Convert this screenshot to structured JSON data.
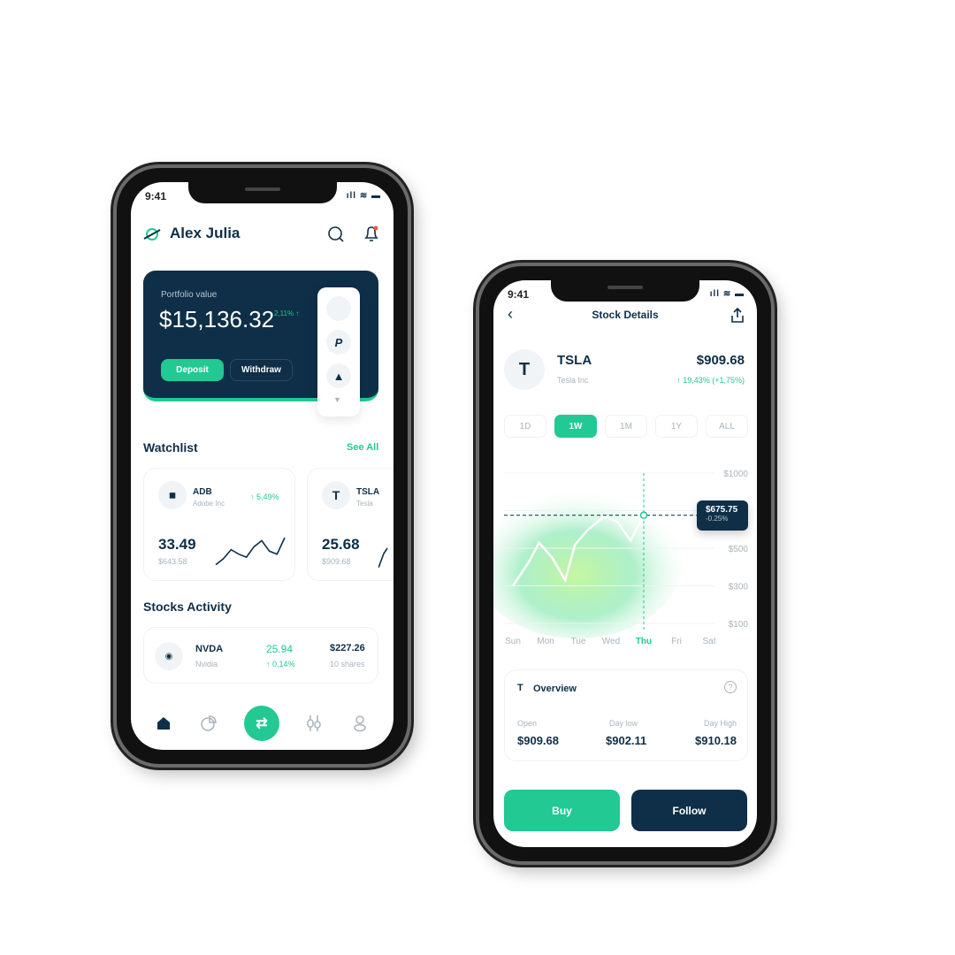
{
  "colors": {
    "navy": "#0e2f47",
    "green": "#22c992",
    "muted": "#a9b3bd"
  },
  "home": {
    "status": {
      "time": "9:41"
    },
    "header": {
      "logo_icon": "planet-icon",
      "user_name": "Alex Julia",
      "search_icon": "search-icon",
      "bell_icon": "bell-icon"
    },
    "portfolio": {
      "label": "Portfolio value",
      "value": "$15,136.32",
      "change": "2,11% ↑",
      "deposit": "Deposit",
      "withdraw": "Withdraw",
      "payment_icons": [
        "apple-icon",
        "paypal-icon",
        "atlassian-icon"
      ]
    },
    "watchlist": {
      "title": "Watchlist",
      "see_all": "See All",
      "items": [
        {
          "ticker": "ADB",
          "name": "Adobe Inc",
          "change": "↑ 5,49%",
          "value": "33.49",
          "price": "$643.58",
          "spark": [
            2,
            6,
            12,
            9,
            7,
            14,
            18,
            11,
            9,
            20
          ]
        },
        {
          "ticker": "TSLA",
          "name": "Tesla",
          "value": "25.68",
          "price": "$909.68",
          "spark": [
            2,
            8,
            14
          ]
        }
      ]
    },
    "activity": {
      "title": "Stocks Activity",
      "items": [
        {
          "ticker": "NVDA",
          "name": "Nvidia",
          "value": "25.94",
          "change": "↑ 0,14%",
          "amount": "$227.26",
          "shares": "10 shares"
        }
      ]
    },
    "nav": [
      "home-icon",
      "pie-chart-icon",
      "transfer-icon",
      "candlestick-icon",
      "profile-icon"
    ]
  },
  "details": {
    "status": {
      "time": "9:41"
    },
    "header": {
      "title": "Stock Details"
    },
    "stock": {
      "ticker": "TSLA",
      "name": "Tesla Inc",
      "price": "$909.68",
      "change": "↑ 19,43% (+1,75%)"
    },
    "ranges": [
      "1D",
      "1W",
      "1M",
      "1Y",
      "ALL"
    ],
    "selected_range": "1W",
    "chart_data": {
      "type": "line",
      "x_labels": [
        "Sun",
        "Mon",
        "Tue",
        "Wed",
        "Thu",
        "Fri",
        "Sat"
      ],
      "highlight": "Thu",
      "y_ticks": [
        "$1000",
        "$700",
        "$500",
        "$300",
        "$100"
      ],
      "x": [
        0,
        0.5,
        0.8,
        1.2,
        1.6,
        1.9,
        2.3,
        2.8,
        3.2,
        3.6,
        4
      ],
      "y": [
        300,
        430,
        530,
        450,
        330,
        520,
        600,
        670,
        640,
        540,
        675.75
      ],
      "tooltip": {
        "value": "$675.75",
        "change": "-0.25%"
      }
    },
    "overview": {
      "title": "Overview",
      "stats": [
        {
          "label": "Open",
          "value": "$909.68"
        },
        {
          "label": "Day low",
          "value": "$902.11"
        },
        {
          "label": "Day High",
          "value": "$910.18"
        }
      ]
    },
    "buy": "Buy",
    "follow": "Follow"
  }
}
